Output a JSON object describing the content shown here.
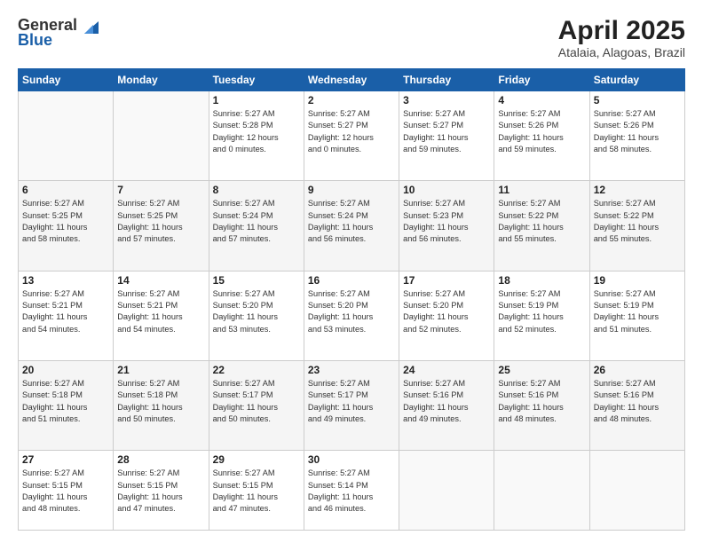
{
  "logo": {
    "general": "General",
    "blue": "Blue"
  },
  "title": "April 2025",
  "location": "Atalaia, Alagoas, Brazil",
  "headers": [
    "Sunday",
    "Monday",
    "Tuesday",
    "Wednesday",
    "Thursday",
    "Friday",
    "Saturday"
  ],
  "weeks": [
    [
      {
        "day": "",
        "info": ""
      },
      {
        "day": "",
        "info": ""
      },
      {
        "day": "1",
        "info": "Sunrise: 5:27 AM\nSunset: 5:28 PM\nDaylight: 12 hours\nand 0 minutes."
      },
      {
        "day": "2",
        "info": "Sunrise: 5:27 AM\nSunset: 5:27 PM\nDaylight: 12 hours\nand 0 minutes."
      },
      {
        "day": "3",
        "info": "Sunrise: 5:27 AM\nSunset: 5:27 PM\nDaylight: 11 hours\nand 59 minutes."
      },
      {
        "day": "4",
        "info": "Sunrise: 5:27 AM\nSunset: 5:26 PM\nDaylight: 11 hours\nand 59 minutes."
      },
      {
        "day": "5",
        "info": "Sunrise: 5:27 AM\nSunset: 5:26 PM\nDaylight: 11 hours\nand 58 minutes."
      }
    ],
    [
      {
        "day": "6",
        "info": "Sunrise: 5:27 AM\nSunset: 5:25 PM\nDaylight: 11 hours\nand 58 minutes."
      },
      {
        "day": "7",
        "info": "Sunrise: 5:27 AM\nSunset: 5:25 PM\nDaylight: 11 hours\nand 57 minutes."
      },
      {
        "day": "8",
        "info": "Sunrise: 5:27 AM\nSunset: 5:24 PM\nDaylight: 11 hours\nand 57 minutes."
      },
      {
        "day": "9",
        "info": "Sunrise: 5:27 AM\nSunset: 5:24 PM\nDaylight: 11 hours\nand 56 minutes."
      },
      {
        "day": "10",
        "info": "Sunrise: 5:27 AM\nSunset: 5:23 PM\nDaylight: 11 hours\nand 56 minutes."
      },
      {
        "day": "11",
        "info": "Sunrise: 5:27 AM\nSunset: 5:22 PM\nDaylight: 11 hours\nand 55 minutes."
      },
      {
        "day": "12",
        "info": "Sunrise: 5:27 AM\nSunset: 5:22 PM\nDaylight: 11 hours\nand 55 minutes."
      }
    ],
    [
      {
        "day": "13",
        "info": "Sunrise: 5:27 AM\nSunset: 5:21 PM\nDaylight: 11 hours\nand 54 minutes."
      },
      {
        "day": "14",
        "info": "Sunrise: 5:27 AM\nSunset: 5:21 PM\nDaylight: 11 hours\nand 54 minutes."
      },
      {
        "day": "15",
        "info": "Sunrise: 5:27 AM\nSunset: 5:20 PM\nDaylight: 11 hours\nand 53 minutes."
      },
      {
        "day": "16",
        "info": "Sunrise: 5:27 AM\nSunset: 5:20 PM\nDaylight: 11 hours\nand 53 minutes."
      },
      {
        "day": "17",
        "info": "Sunrise: 5:27 AM\nSunset: 5:20 PM\nDaylight: 11 hours\nand 52 minutes."
      },
      {
        "day": "18",
        "info": "Sunrise: 5:27 AM\nSunset: 5:19 PM\nDaylight: 11 hours\nand 52 minutes."
      },
      {
        "day": "19",
        "info": "Sunrise: 5:27 AM\nSunset: 5:19 PM\nDaylight: 11 hours\nand 51 minutes."
      }
    ],
    [
      {
        "day": "20",
        "info": "Sunrise: 5:27 AM\nSunset: 5:18 PM\nDaylight: 11 hours\nand 51 minutes."
      },
      {
        "day": "21",
        "info": "Sunrise: 5:27 AM\nSunset: 5:18 PM\nDaylight: 11 hours\nand 50 minutes."
      },
      {
        "day": "22",
        "info": "Sunrise: 5:27 AM\nSunset: 5:17 PM\nDaylight: 11 hours\nand 50 minutes."
      },
      {
        "day": "23",
        "info": "Sunrise: 5:27 AM\nSunset: 5:17 PM\nDaylight: 11 hours\nand 49 minutes."
      },
      {
        "day": "24",
        "info": "Sunrise: 5:27 AM\nSunset: 5:16 PM\nDaylight: 11 hours\nand 49 minutes."
      },
      {
        "day": "25",
        "info": "Sunrise: 5:27 AM\nSunset: 5:16 PM\nDaylight: 11 hours\nand 48 minutes."
      },
      {
        "day": "26",
        "info": "Sunrise: 5:27 AM\nSunset: 5:16 PM\nDaylight: 11 hours\nand 48 minutes."
      }
    ],
    [
      {
        "day": "27",
        "info": "Sunrise: 5:27 AM\nSunset: 5:15 PM\nDaylight: 11 hours\nand 48 minutes."
      },
      {
        "day": "28",
        "info": "Sunrise: 5:27 AM\nSunset: 5:15 PM\nDaylight: 11 hours\nand 47 minutes."
      },
      {
        "day": "29",
        "info": "Sunrise: 5:27 AM\nSunset: 5:15 PM\nDaylight: 11 hours\nand 47 minutes."
      },
      {
        "day": "30",
        "info": "Sunrise: 5:27 AM\nSunset: 5:14 PM\nDaylight: 11 hours\nand 46 minutes."
      },
      {
        "day": "",
        "info": ""
      },
      {
        "day": "",
        "info": ""
      },
      {
        "day": "",
        "info": ""
      }
    ]
  ]
}
